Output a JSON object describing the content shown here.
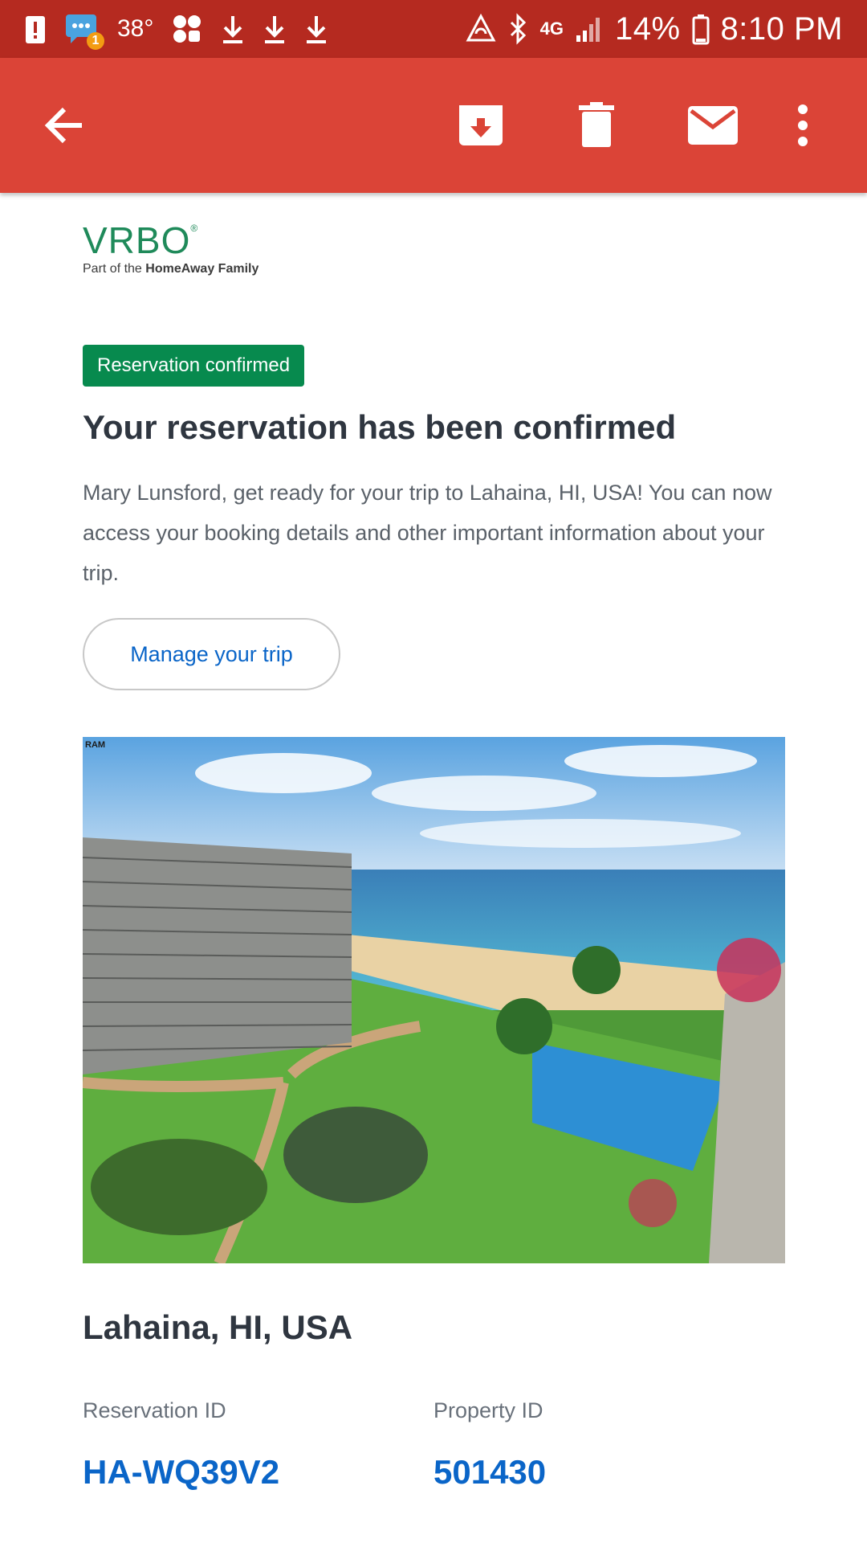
{
  "status_bar": {
    "temperature": "38°",
    "network": "4G",
    "battery": "14%",
    "time": "8:10 PM",
    "notification_count": "1",
    "left_icons": [
      "alert-icon",
      "message-icon",
      "temperature",
      "app-icon",
      "download-icon",
      "download-icon",
      "download-icon"
    ],
    "right_icons": [
      "sync-icon",
      "bluetooth-icon",
      "network-4g-icon",
      "signal-icon",
      "battery-icon"
    ]
  },
  "app_bar": {
    "color": "#db4437",
    "actions": [
      "back-arrow-icon",
      "archive-icon",
      "delete-icon",
      "mark-unread-icon",
      "more-vert-icon"
    ]
  },
  "email": {
    "logo": {
      "word": "VRBO",
      "tag_prefix": "Part of the ",
      "tag_brand": "HomeAway Family"
    },
    "badge": "Reservation confirmed",
    "headline": "Your reservation has been confirmed",
    "intro": "Mary Lunsford, get ready for your trip to Lahaina, HI, USA! You can now access your booking details and other important information about your trip.",
    "manage_button": "Manage your trip",
    "photo_watermark": "RAM",
    "location": "Lahaina, HI, USA",
    "reservation_label": "Reservation ID",
    "reservation_id": "HA-WQ39V2",
    "property_label": "Property ID",
    "property_id": "501430"
  },
  "colors": {
    "status_bar": "#b52a20",
    "badge": "#078a4e",
    "link": "#0a65c8",
    "logo": "#1f8a5a"
  }
}
